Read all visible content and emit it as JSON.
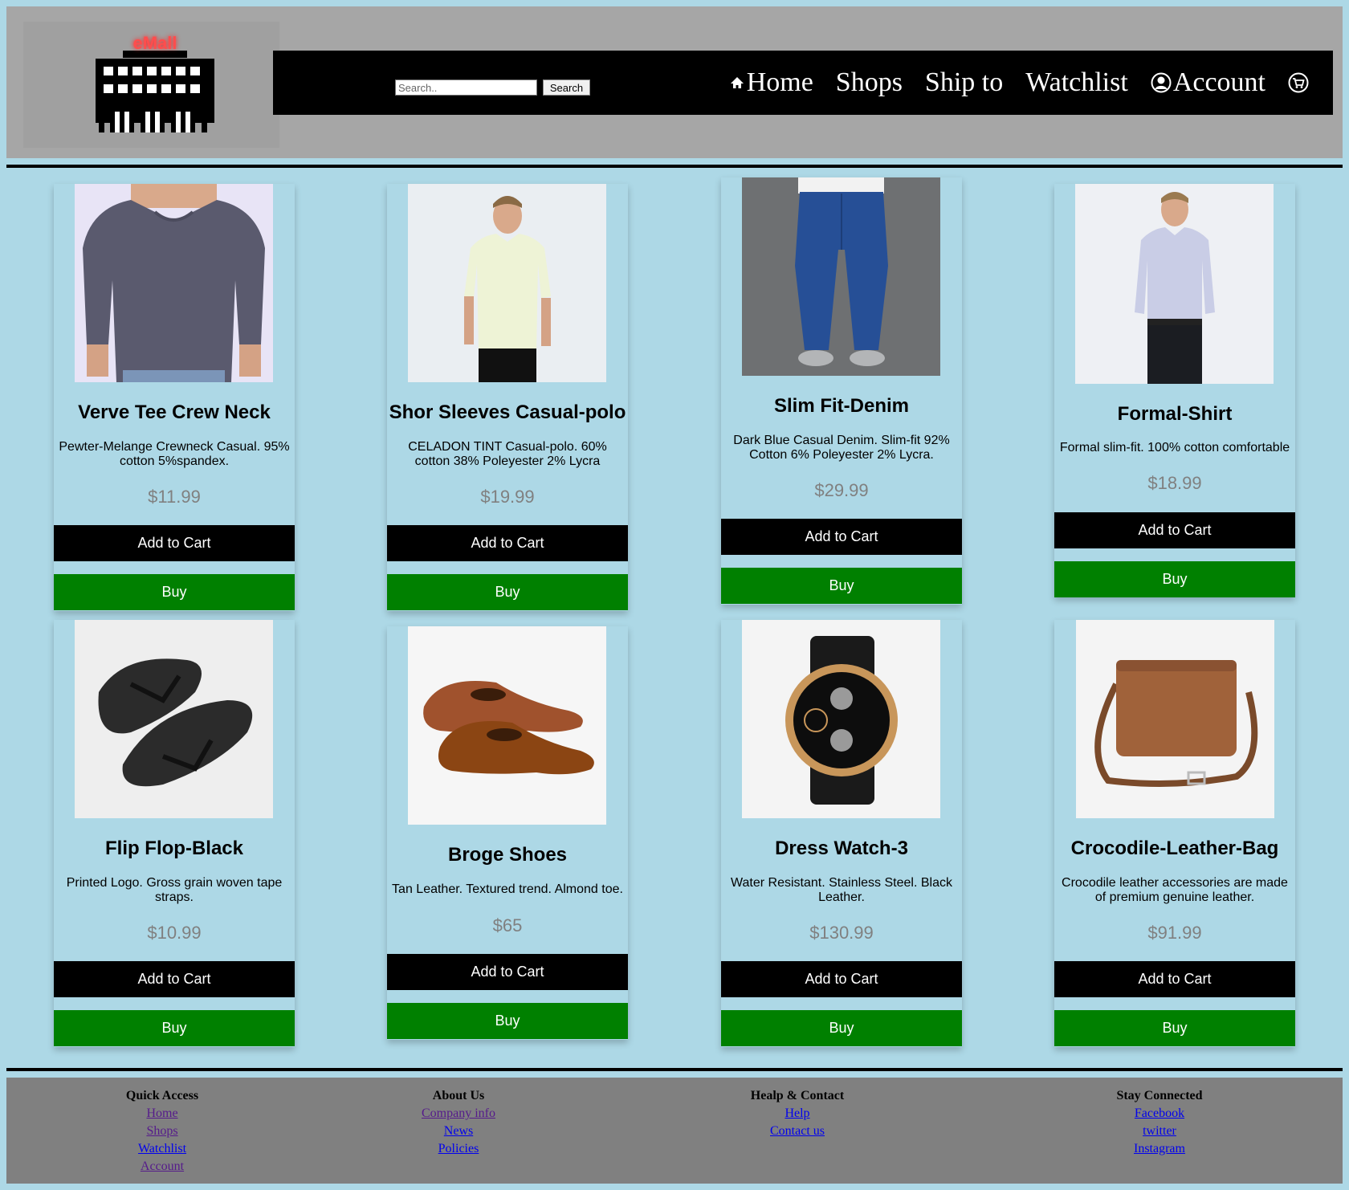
{
  "brand": {
    "logo_text": "eMall"
  },
  "search": {
    "placeholder": "Search..",
    "button_label": "Search"
  },
  "nav": {
    "home": "Home",
    "shops": "Shops",
    "ship_to": "Ship to",
    "watchlist": "Watchlist",
    "account": "Account"
  },
  "icons": {
    "home": "home-icon",
    "account": "user-circle-icon",
    "cart": "cart-icon"
  },
  "colors": {
    "header_bg": "#a6a6a6",
    "page_bg": "#add8e6",
    "navbar_bg": "#000000",
    "buy": "#008000",
    "add_to_cart": "#000000",
    "footer_bg": "#808080",
    "logo_text": "#ff4d4d"
  },
  "buttons": {
    "add_to_cart": "Add to Cart",
    "buy": "Buy"
  },
  "products": [
    {
      "title": "Verve Tee Crew Neck",
      "desc": "Pewter-Melange Crewneck Casual. 95% cotton 5%spandex.",
      "price": "$11.99",
      "image": "grey-tshirt"
    },
    {
      "title": "Shor Sleeves Casual-polo",
      "desc": "CELADON TINT Casual-polo. 60% cotton 38% Poleyester 2% Lycra",
      "price": "$19.99",
      "image": "polo-shirt"
    },
    {
      "title": "Slim Fit-Denim",
      "desc": "Dark Blue Casual Denim. Slim-fit 92% Cotton 6% Poleyester 2% Lycra.",
      "price": "$29.99",
      "image": "denim-jeans"
    },
    {
      "title": "Formal-Shirt",
      "desc": "Formal slim-fit. 100% cotton comfortable",
      "price": "$18.99",
      "image": "formal-shirt"
    },
    {
      "title": "Flip Flop-Black",
      "desc": "Printed Logo. Gross grain woven tape straps.",
      "price": "$10.99",
      "image": "flip-flops"
    },
    {
      "title": "Broge Shoes",
      "desc": "Tan Leather. Textured trend. Almond toe.",
      "price": "$65",
      "image": "brogue-shoes"
    },
    {
      "title": "Dress Watch-3",
      "desc": "Water Resistant. Stainless Steel. Black Leather.",
      "price": "$130.99",
      "image": "wrist-watch"
    },
    {
      "title": "Crocodile-Leather-Bag",
      "desc": "Crocodile leather accessories are made of premium genuine leather.",
      "price": "$91.99",
      "image": "leather-bag"
    }
  ],
  "footer": {
    "columns": [
      {
        "heading": "Quick Access",
        "links": [
          "Home",
          "Shops",
          "Watchlist",
          "Account"
        ]
      },
      {
        "heading": "About Us",
        "links": [
          "Company info",
          "News",
          "Policies"
        ]
      },
      {
        "heading": "Healp & Contact",
        "links": [
          "Help",
          "Contact us"
        ]
      },
      {
        "heading": "Stay Connected",
        "links": [
          "Facebook",
          "twitter",
          "Instagram"
        ]
      }
    ]
  }
}
